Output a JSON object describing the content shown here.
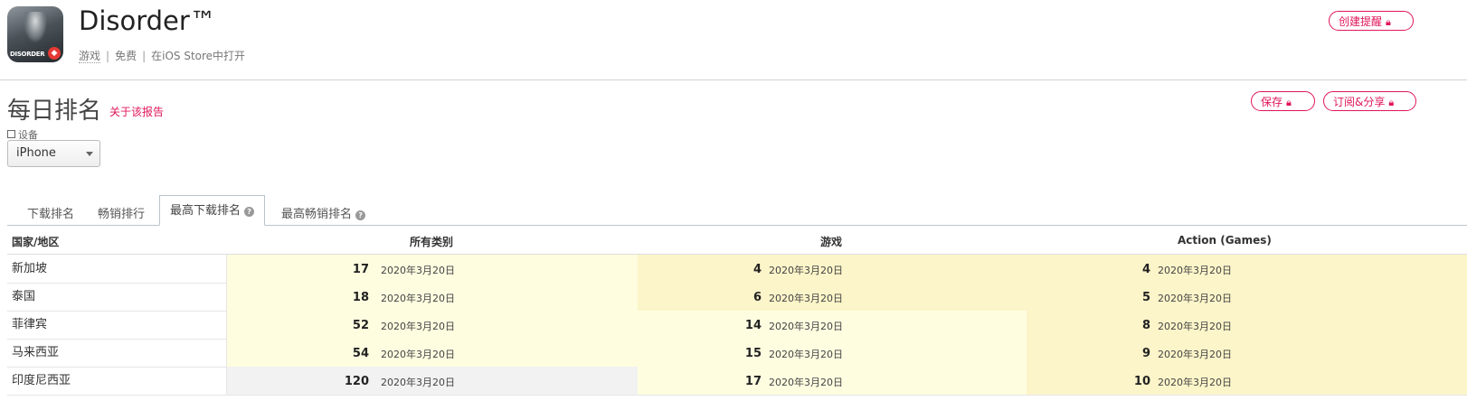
{
  "app": {
    "name": "Disorder™",
    "icon_text": "DISORDER",
    "category": "游戏",
    "price": "免费",
    "store_link": "在iOS Store中打开"
  },
  "header_actions": {
    "create_alert": "创建提醒",
    "save": "保存",
    "subscribe_share": "订阅&分享"
  },
  "section": {
    "title": "每日排名",
    "about": "关于该报告"
  },
  "device": {
    "label": "设备",
    "selected": "iPhone"
  },
  "tabs": [
    {
      "label": "下载排名",
      "active": false
    },
    {
      "label": "畅销排行",
      "active": false
    },
    {
      "label": "最高下载排名",
      "active": true
    },
    {
      "label": "最高畅销排名",
      "active": false
    }
  ],
  "table": {
    "headers": [
      "国家/地区",
      "所有类别",
      "游戏",
      "Action (Games)"
    ],
    "rows": [
      {
        "country": "新加坡",
        "all": {
          "rank": "17",
          "date": "2020年3月20日"
        },
        "games": {
          "rank": "4",
          "date": "2020年3月20日"
        },
        "action": {
          "rank": "4",
          "date": "2020年3月20日"
        }
      },
      {
        "country": "泰国",
        "all": {
          "rank": "18",
          "date": "2020年3月20日"
        },
        "games": {
          "rank": "6",
          "date": "2020年3月20日"
        },
        "action": {
          "rank": "5",
          "date": "2020年3月20日"
        }
      },
      {
        "country": "菲律宾",
        "all": {
          "rank": "52",
          "date": "2020年3月20日"
        },
        "games": {
          "rank": "14",
          "date": "2020年3月20日"
        },
        "action": {
          "rank": "8",
          "date": "2020年3月20日"
        }
      },
      {
        "country": "马来西亚",
        "all": {
          "rank": "54",
          "date": "2020年3月20日"
        },
        "games": {
          "rank": "15",
          "date": "2020年3月20日"
        },
        "action": {
          "rank": "9",
          "date": "2020年3月20日"
        }
      },
      {
        "country": "印度尼西亚",
        "all": {
          "rank": "120",
          "date": "2020年3月20日"
        },
        "games": {
          "rank": "17",
          "date": "2020年3月20日"
        },
        "action": {
          "rank": "10",
          "date": "2020年3月20日"
        }
      }
    ],
    "cell_colors": {
      "light": "#fefde0",
      "medium": "#fcf5c9",
      "gray": "#f2f2f2"
    }
  },
  "accent_color": "#e0165a"
}
